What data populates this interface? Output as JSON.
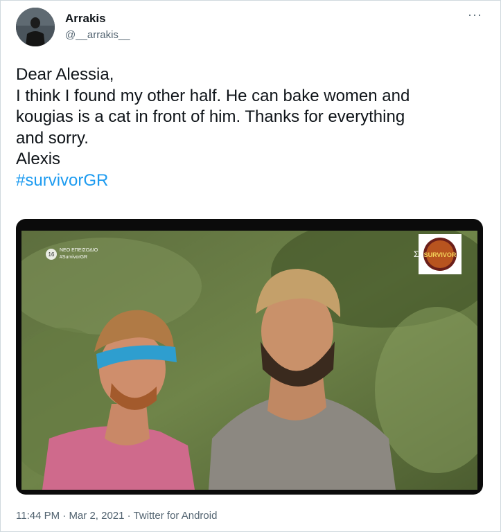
{
  "author": {
    "name": "Arrakis",
    "handle": "@__arrakis__"
  },
  "more_menu": {
    "glyph": "···",
    "icon": "more-horizontal-icon"
  },
  "tweet": {
    "lines": [
      "Dear Alessia,",
      "I think I found my other half. He can bake women and",
      "kougias is a cat in front of him. Thanks for everything",
      "and sorry.",
      "Alexis"
    ],
    "hashtag": "#survivorGR"
  },
  "media": {
    "overlay_line1": "ΝΕΟ ΕΠΕΙΣΟΔΙΟ",
    "overlay_line2": "#SurvivorGR",
    "rating_badge": "16",
    "channel_mark": "Σ",
    "logo_text": "SURVIVOR"
  },
  "meta": {
    "time": "11:44 PM",
    "separator": "·",
    "date": "Mar 2, 2021",
    "source": "Twitter for Android"
  },
  "colors": {
    "hashtag": "#1d9bf0",
    "secondary_text": "#536471",
    "border": "#cfd9de"
  }
}
